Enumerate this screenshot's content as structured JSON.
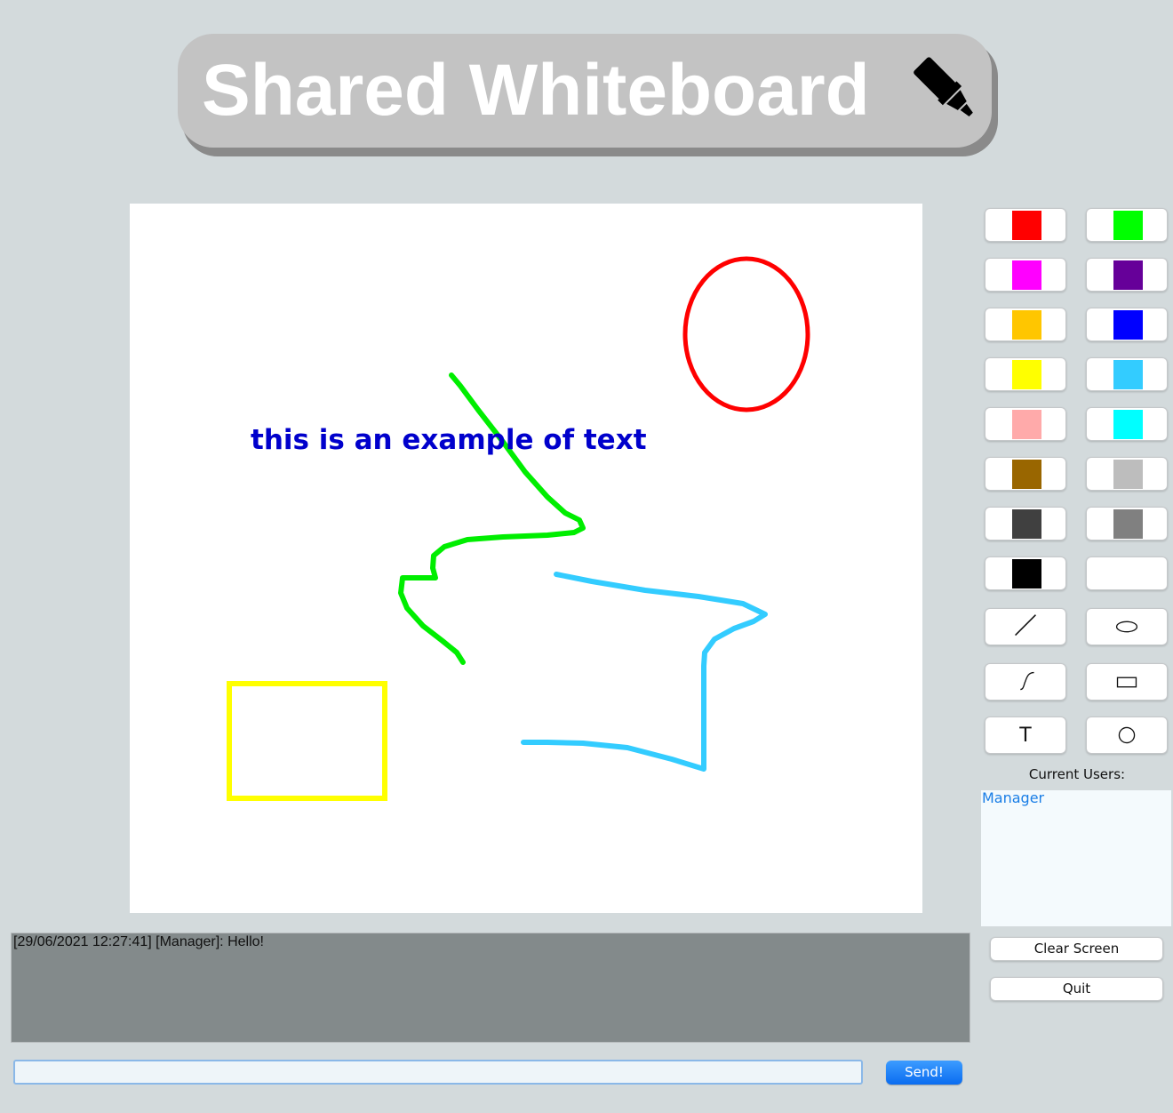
{
  "app": {
    "title": "Shared Whiteboard",
    "title_icon": "marker-icon"
  },
  "canvas": {
    "text_annotation": "this is an example of text",
    "text_color": "#0000cc",
    "shapes": [
      {
        "kind": "freehand",
        "color": "#00ee00"
      },
      {
        "kind": "freehand",
        "color": "#33ccff"
      },
      {
        "kind": "oval",
        "color": "#ff0000"
      },
      {
        "kind": "rectangle",
        "color": "#ffff00"
      }
    ]
  },
  "palette": {
    "colors": [
      {
        "name": "red",
        "hex": "#ff0000"
      },
      {
        "name": "green",
        "hex": "#00ff00"
      },
      {
        "name": "magenta",
        "hex": "#ff00ff"
      },
      {
        "name": "purple",
        "hex": "#660099"
      },
      {
        "name": "orange",
        "hex": "#ffc600"
      },
      {
        "name": "blue",
        "hex": "#0000ff"
      },
      {
        "name": "yellow",
        "hex": "#ffff00"
      },
      {
        "name": "light-blue",
        "hex": "#33ccff"
      },
      {
        "name": "pink",
        "hex": "#ffaaaa"
      },
      {
        "name": "cyan",
        "hex": "#00ffff"
      },
      {
        "name": "brown",
        "hex": "#996600"
      },
      {
        "name": "light-gray",
        "hex": "#bdbdbd"
      },
      {
        "name": "dark-gray",
        "hex": "#404040"
      },
      {
        "name": "gray",
        "hex": "#808080"
      },
      {
        "name": "black",
        "hex": "#000000"
      },
      {
        "name": "white",
        "hex": "#ffffff"
      }
    ]
  },
  "tools": [
    {
      "name": "line",
      "icon": "line-icon"
    },
    {
      "name": "oval",
      "icon": "oval-icon"
    },
    {
      "name": "freehand",
      "icon": "freehand-icon"
    },
    {
      "name": "rectangle",
      "icon": "rectangle-icon"
    },
    {
      "name": "text",
      "icon": "text-icon",
      "glyph": "T"
    },
    {
      "name": "circle",
      "icon": "circle-icon"
    }
  ],
  "users": {
    "label": "Current Users:",
    "list": [
      "Manager"
    ]
  },
  "actions": {
    "clear_label": "Clear Screen",
    "quit_label": "Quit"
  },
  "chat": {
    "messages": [
      "[29/06/2021 12:27:41] [Manager]: Hello!"
    ],
    "input_value": "",
    "send_label": "Send!"
  }
}
